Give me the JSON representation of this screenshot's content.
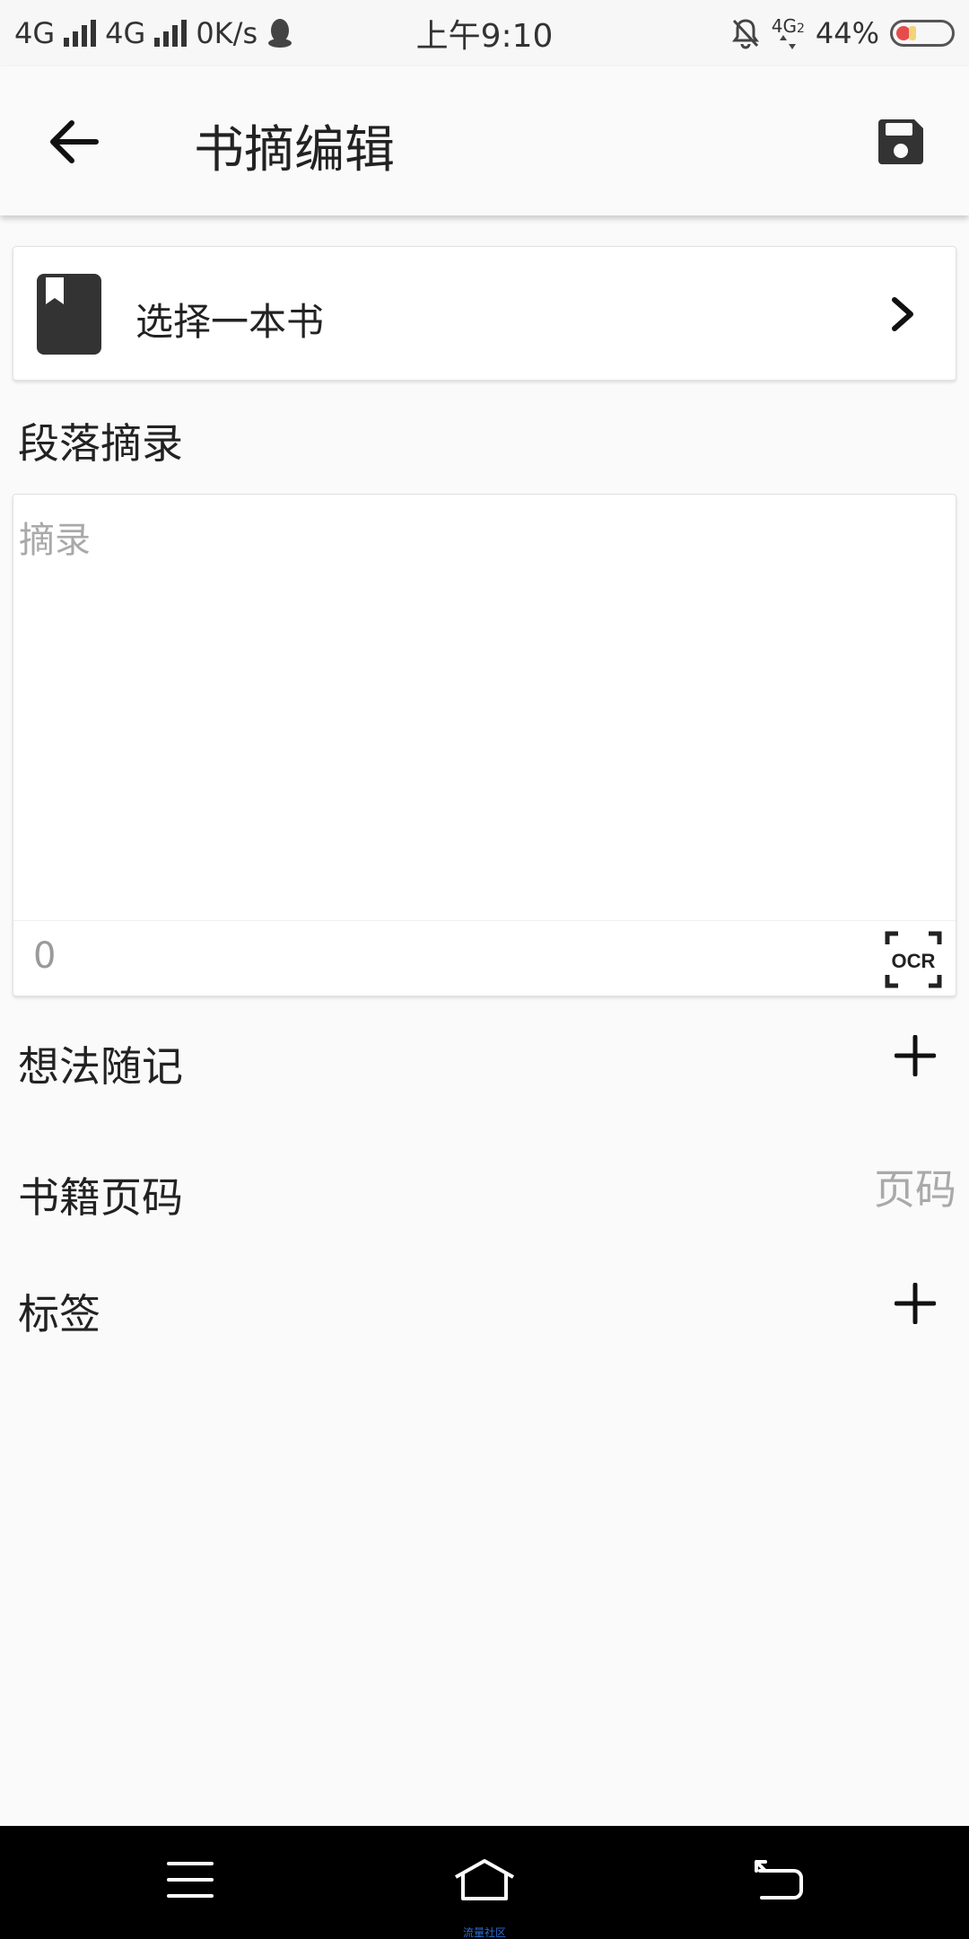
{
  "status_bar": {
    "network1": "4G",
    "network2": "4G",
    "speed": "0K/s",
    "time": "上午9:10",
    "network3": "4G",
    "network3_sub": "2",
    "battery": "44%"
  },
  "app_bar": {
    "title": "书摘编辑"
  },
  "book_select": {
    "label": "选择一本书"
  },
  "excerpt": {
    "section_title": "段落摘录",
    "placeholder": "摘录",
    "char_count": "0",
    "ocr_label": "OCR"
  },
  "thoughts": {
    "label": "想法随记"
  },
  "page_number": {
    "label": "书籍页码",
    "placeholder": "页码"
  },
  "tags": {
    "label": "标签"
  },
  "nav_bar": {
    "caption": "流量社区"
  }
}
